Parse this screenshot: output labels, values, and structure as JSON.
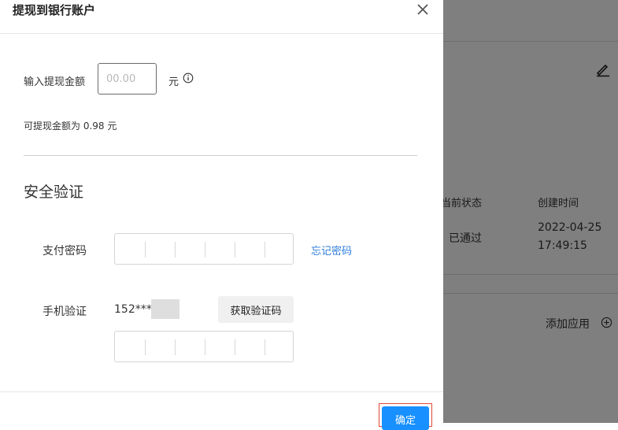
{
  "background": {
    "status_header": "当前状态",
    "created_header": "创建时间",
    "status_value": "已通过",
    "created_date": "2022-04-25",
    "created_time": "17:49:15",
    "add_app_label": "添加应用"
  },
  "dialog": {
    "title": "提现到银行账户",
    "amount_label": "输入提现金额",
    "amount_placeholder": "00.00",
    "amount_unit": "元",
    "available_text": "可提现金额为 0.98 元",
    "security_title": "安全验证",
    "pay_password_label": "支付密码",
    "forgot_password_link": "忘记密码",
    "phone_label": "手机验证",
    "phone_number": "152****",
    "get_code_button": "获取验证码",
    "confirm_button": "确定"
  },
  "colors": {
    "primary": "#1890ff",
    "link": "#2f7ddc",
    "highlight_outline": "#e0483b"
  },
  "icons": [
    "close-icon",
    "info-icon",
    "edit-pencil-icon",
    "add-circle-icon"
  ]
}
